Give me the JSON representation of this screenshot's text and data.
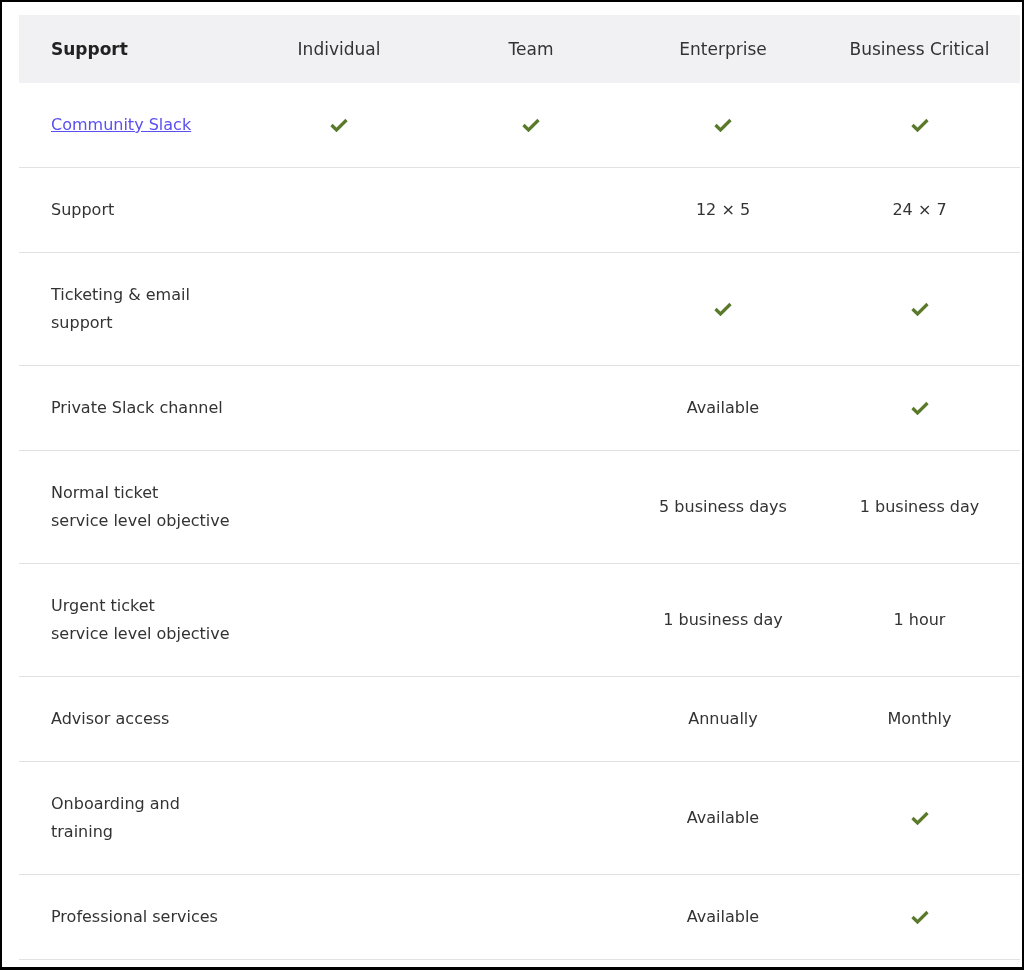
{
  "table": {
    "columns": [
      "Support",
      "Individual",
      "Team",
      "Enterprise",
      "Business Critical"
    ],
    "rows": [
      {
        "cells": [
          {
            "kind": "link",
            "text": "Community Slack"
          },
          {
            "kind": "check"
          },
          {
            "kind": "check"
          },
          {
            "kind": "check"
          },
          {
            "kind": "check"
          }
        ]
      },
      {
        "cells": [
          {
            "kind": "label",
            "text": "Support"
          },
          {
            "kind": "empty"
          },
          {
            "kind": "empty"
          },
          {
            "kind": "text",
            "text": "12 × 5"
          },
          {
            "kind": "text",
            "text": "24 × 7"
          }
        ]
      },
      {
        "cells": [
          {
            "kind": "label",
            "text": "Ticketing & email\nsupport"
          },
          {
            "kind": "empty"
          },
          {
            "kind": "empty"
          },
          {
            "kind": "check"
          },
          {
            "kind": "check"
          }
        ]
      },
      {
        "cells": [
          {
            "kind": "label",
            "text": "Private Slack channel"
          },
          {
            "kind": "empty"
          },
          {
            "kind": "empty"
          },
          {
            "kind": "text",
            "text": "Available"
          },
          {
            "kind": "check"
          }
        ]
      },
      {
        "cells": [
          {
            "kind": "label",
            "text": "Normal ticket\nservice level objective"
          },
          {
            "kind": "empty"
          },
          {
            "kind": "empty"
          },
          {
            "kind": "text",
            "text": "5 business days"
          },
          {
            "kind": "text",
            "text": "1 business day"
          }
        ]
      },
      {
        "cells": [
          {
            "kind": "label",
            "text": "Urgent ticket\nservice level objective"
          },
          {
            "kind": "empty"
          },
          {
            "kind": "empty"
          },
          {
            "kind": "text",
            "text": "1 business day"
          },
          {
            "kind": "text",
            "text": "1 hour"
          }
        ]
      },
      {
        "cells": [
          {
            "kind": "label",
            "text": "Advisor access"
          },
          {
            "kind": "empty"
          },
          {
            "kind": "empty"
          },
          {
            "kind": "text",
            "text": "Annually"
          },
          {
            "kind": "text",
            "text": "Monthly"
          }
        ]
      },
      {
        "cells": [
          {
            "kind": "label",
            "text": "Onboarding and\ntraining"
          },
          {
            "kind": "empty"
          },
          {
            "kind": "empty"
          },
          {
            "kind": "text",
            "text": "Available"
          },
          {
            "kind": "check"
          }
        ]
      },
      {
        "cells": [
          {
            "kind": "label",
            "text": "Professional services"
          },
          {
            "kind": "empty"
          },
          {
            "kind": "empty"
          },
          {
            "kind": "text",
            "text": "Available"
          },
          {
            "kind": "check"
          }
        ]
      }
    ]
  }
}
